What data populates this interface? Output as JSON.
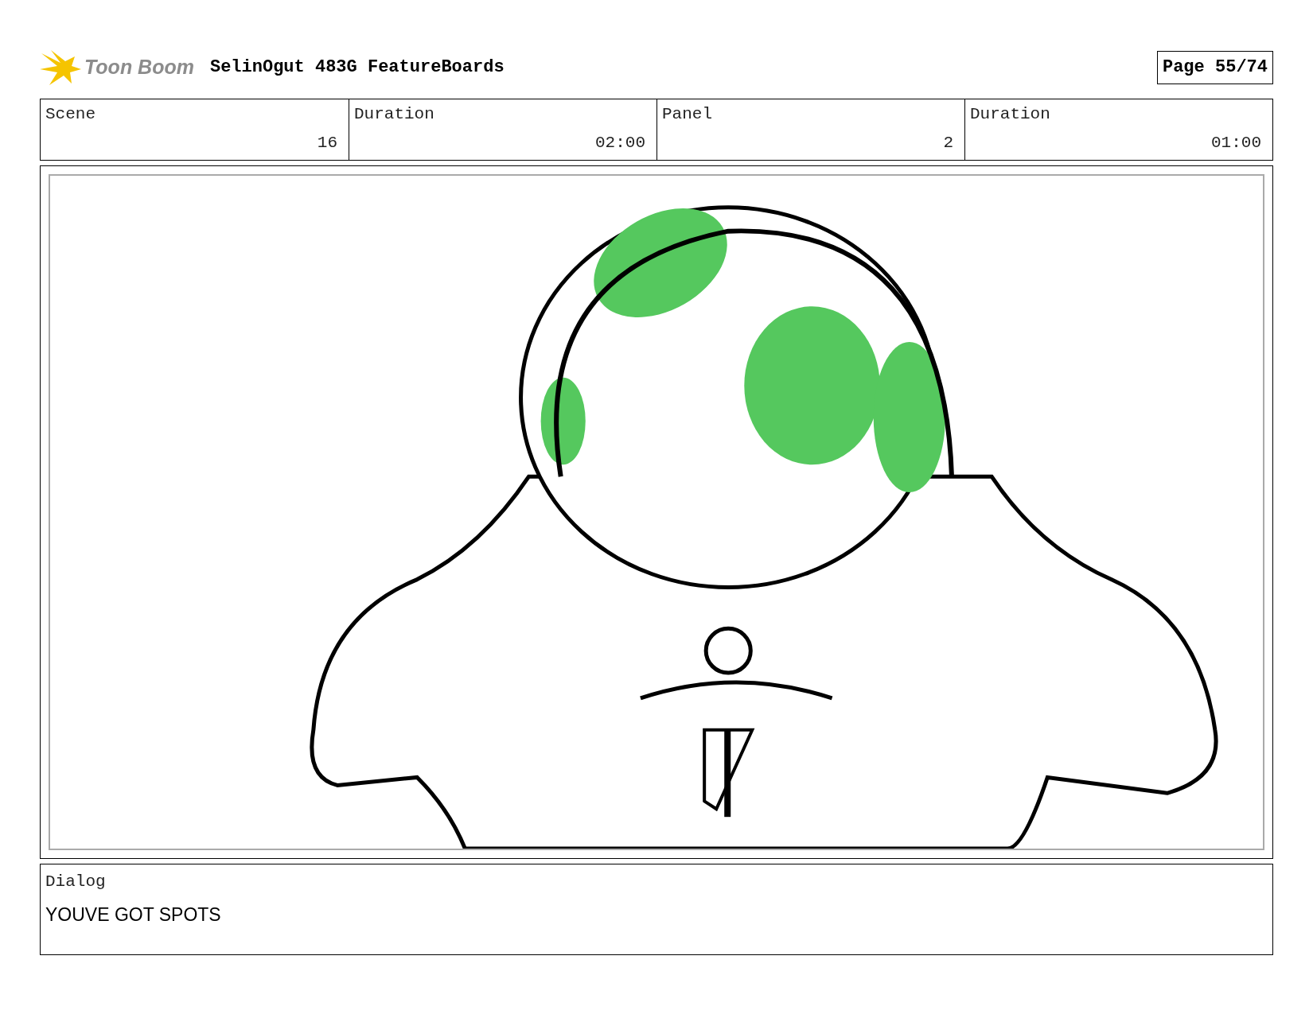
{
  "header": {
    "logo_text": "Toon Boom",
    "project_title": "SelinOgut 483G FeatureBoards",
    "page": "Page 55/74"
  },
  "info": [
    {
      "label": "Scene",
      "value": "16"
    },
    {
      "label": "Duration",
      "value": "02:00"
    },
    {
      "label": "Panel",
      "value": "2"
    },
    {
      "label": "Duration",
      "value": "01:00"
    }
  ],
  "dialog": {
    "label": "Dialog",
    "text": "YOUVE GOT SPOTS"
  }
}
